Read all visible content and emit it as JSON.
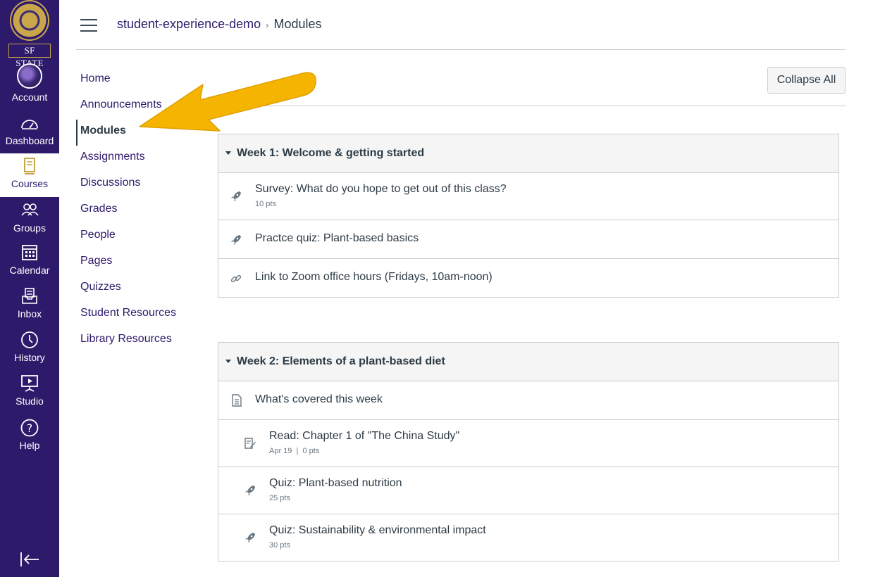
{
  "global_nav": {
    "logo_text": "SF STATE",
    "items": [
      {
        "label": "Account",
        "icon": "avatar-icon"
      },
      {
        "label": "Dashboard",
        "icon": "dashboard-icon"
      },
      {
        "label": "Courses",
        "icon": "courses-icon"
      },
      {
        "label": "Groups",
        "icon": "groups-icon"
      },
      {
        "label": "Calendar",
        "icon": "calendar-icon"
      },
      {
        "label": "Inbox",
        "icon": "inbox-icon"
      },
      {
        "label": "History",
        "icon": "history-icon"
      },
      {
        "label": "Studio",
        "icon": "studio-icon"
      },
      {
        "label": "Help",
        "icon": "help-icon"
      }
    ],
    "active": "Courses",
    "brand_color": "#2e1a6b"
  },
  "breadcrumb": {
    "course": "student-experience-demo",
    "separator": "›",
    "current": "Modules"
  },
  "course_nav": {
    "items": [
      "Home",
      "Announcements",
      "Modules",
      "Assignments",
      "Discussions",
      "Grades",
      "People",
      "Pages",
      "Quizzes",
      "Student Resources",
      "Library Resources"
    ],
    "selected": "Modules"
  },
  "toolbar": {
    "collapse_all": "Collapse All"
  },
  "modules": [
    {
      "title": "Week 1: Welcome & getting started",
      "items": [
        {
          "title": "Survey: What do you hope to get out of this class?",
          "meta": "10 pts",
          "icon": "quiz-rocket-icon"
        },
        {
          "title": "Practce quiz: Plant-based basics",
          "meta": "",
          "icon": "quiz-rocket-icon"
        },
        {
          "title": "Link to Zoom office hours (Fridays, 10am-noon)",
          "meta": "",
          "icon": "link-icon"
        }
      ]
    },
    {
      "title": "Week 2: Elements of a plant-based diet",
      "items": [
        {
          "title": "What's covered this week",
          "meta": "",
          "icon": "page-icon"
        },
        {
          "title": "Read: Chapter 1 of \"The China Study\"",
          "meta": "Apr 19  |  0 pts",
          "icon": "assignment-icon"
        },
        {
          "title": "Quiz: Plant-based nutrition",
          "meta": "25 pts",
          "icon": "quiz-rocket-icon"
        },
        {
          "title": "Quiz: Sustainability & environmental impact",
          "meta": "30 pts",
          "icon": "quiz-rocket-icon"
        }
      ]
    }
  ],
  "annotation_color": "#f5b400"
}
